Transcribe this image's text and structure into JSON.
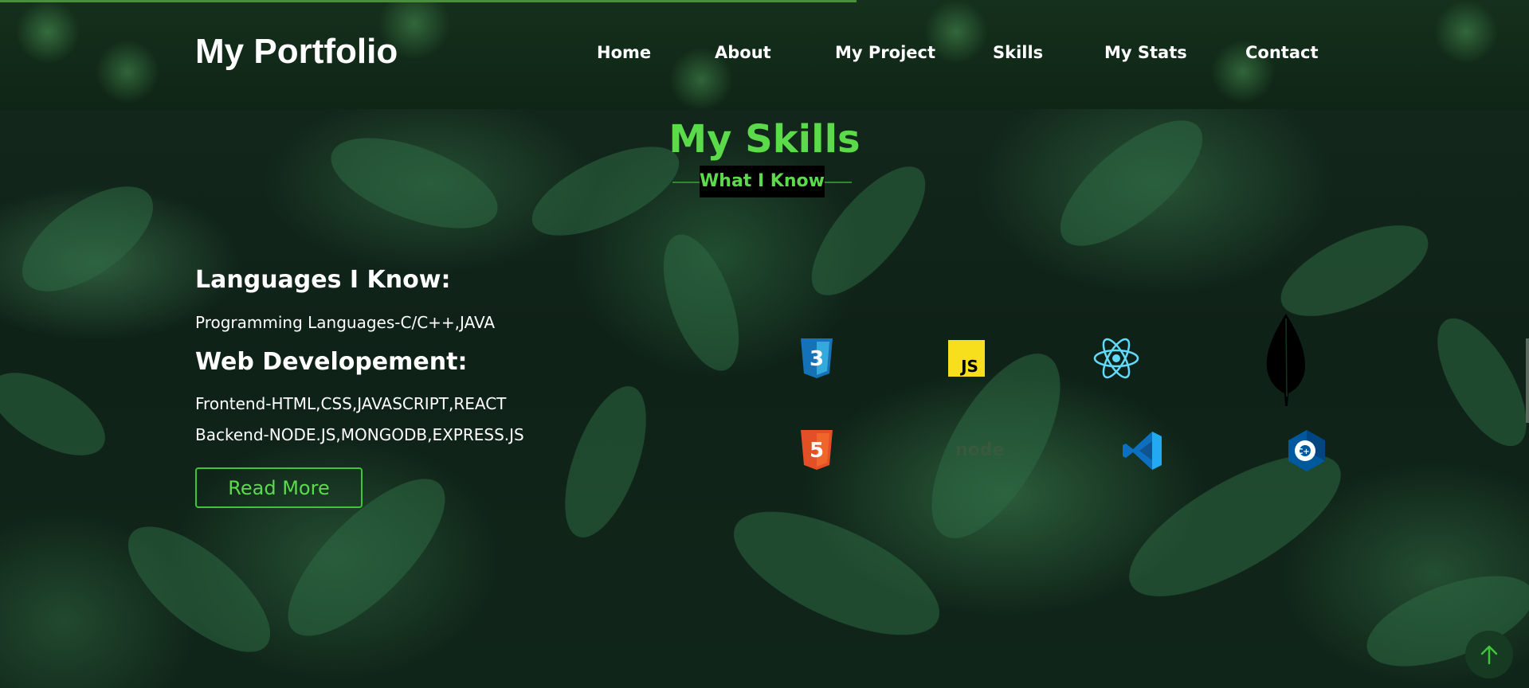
{
  "header": {
    "logo": "My Portfolio",
    "nav": [
      "Home",
      "About",
      "My Project",
      "Skills",
      "My Stats",
      "Contact"
    ],
    "progress_percent": 56
  },
  "skills": {
    "title": "My Skills",
    "subtitle": "What I Know",
    "languages_heading": "Languages I Know:",
    "languages_text": "Programming Languages-C/C++,JAVA",
    "web_heading": "Web Developement:",
    "frontend_text": "Frontend-HTML,CSS,JAVASCRIPT,REACT",
    "backend_text": "Backend-NODE.JS,MONGODB,EXPRESS.JS",
    "read_more": "Read More",
    "icons": [
      "css3-icon",
      "javascript-icon",
      "react-icon",
      "mongodb-icon",
      "html5-icon",
      "nodejs-icon",
      "vscode-icon",
      "cplusplus-icon"
    ],
    "node_label": "node",
    "js_label": "JS",
    "css_digit": "3",
    "html_digit": "5",
    "cpp_label": "C++"
  },
  "colors": {
    "accent": "#5bdb4a",
    "button_border": "#3fc43a",
    "progress": "#4a8f3a"
  }
}
